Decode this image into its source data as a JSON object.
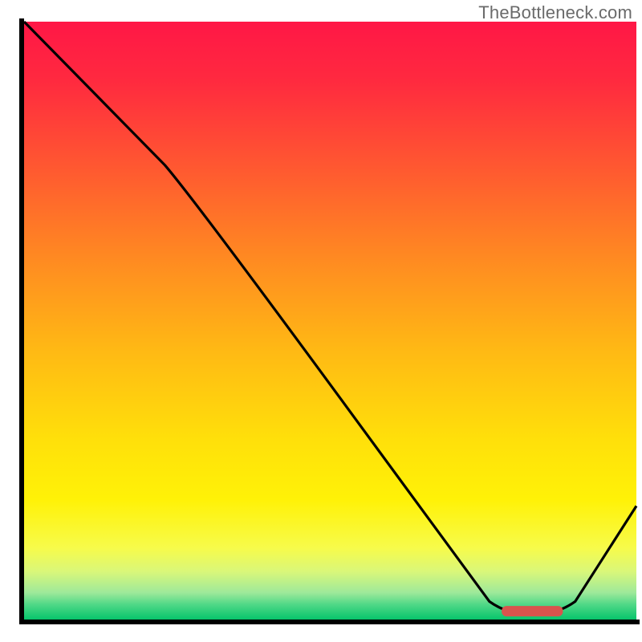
{
  "watermark": "TheBottleneck.com",
  "chart_data": {
    "type": "line",
    "x_range": [
      0,
      100
    ],
    "y_range": [
      0,
      100
    ],
    "curve": [
      {
        "x": 0,
        "y": 100
      },
      {
        "x": 23,
        "y": 76
      },
      {
        "x": 28,
        "y": 70
      },
      {
        "x": 76,
        "y": 3
      },
      {
        "x": 79,
        "y": 0.8
      },
      {
        "x": 87,
        "y": 0.8
      },
      {
        "x": 90,
        "y": 3
      },
      {
        "x": 100,
        "y": 19
      }
    ],
    "marker": {
      "x_start": 78,
      "x_end": 88,
      "y": 1.4
    },
    "gradient_stops": [
      {
        "offset": 0.0,
        "color": "#ff1746"
      },
      {
        "offset": 0.1,
        "color": "#ff2a3f"
      },
      {
        "offset": 0.25,
        "color": "#ff5a30"
      },
      {
        "offset": 0.4,
        "color": "#ff8b21"
      },
      {
        "offset": 0.55,
        "color": "#ffb914"
      },
      {
        "offset": 0.7,
        "color": "#ffe00a"
      },
      {
        "offset": 0.8,
        "color": "#fff207"
      },
      {
        "offset": 0.88,
        "color": "#f7fb4a"
      },
      {
        "offset": 0.92,
        "color": "#d9f77a"
      },
      {
        "offset": 0.955,
        "color": "#9ee99a"
      },
      {
        "offset": 0.975,
        "color": "#4fd887"
      },
      {
        "offset": 1.0,
        "color": "#07c46b"
      }
    ],
    "title": "",
    "xlabel": "",
    "ylabel": "",
    "axes": {
      "left": {
        "x": 3.5,
        "y1": 3,
        "y2": 97
      },
      "bottom": {
        "y": 96.7,
        "x1": 3,
        "x2": 97
      }
    },
    "marker_color": "#d9544d",
    "curve_stroke": "#000000",
    "axis_stroke": "#000000"
  }
}
